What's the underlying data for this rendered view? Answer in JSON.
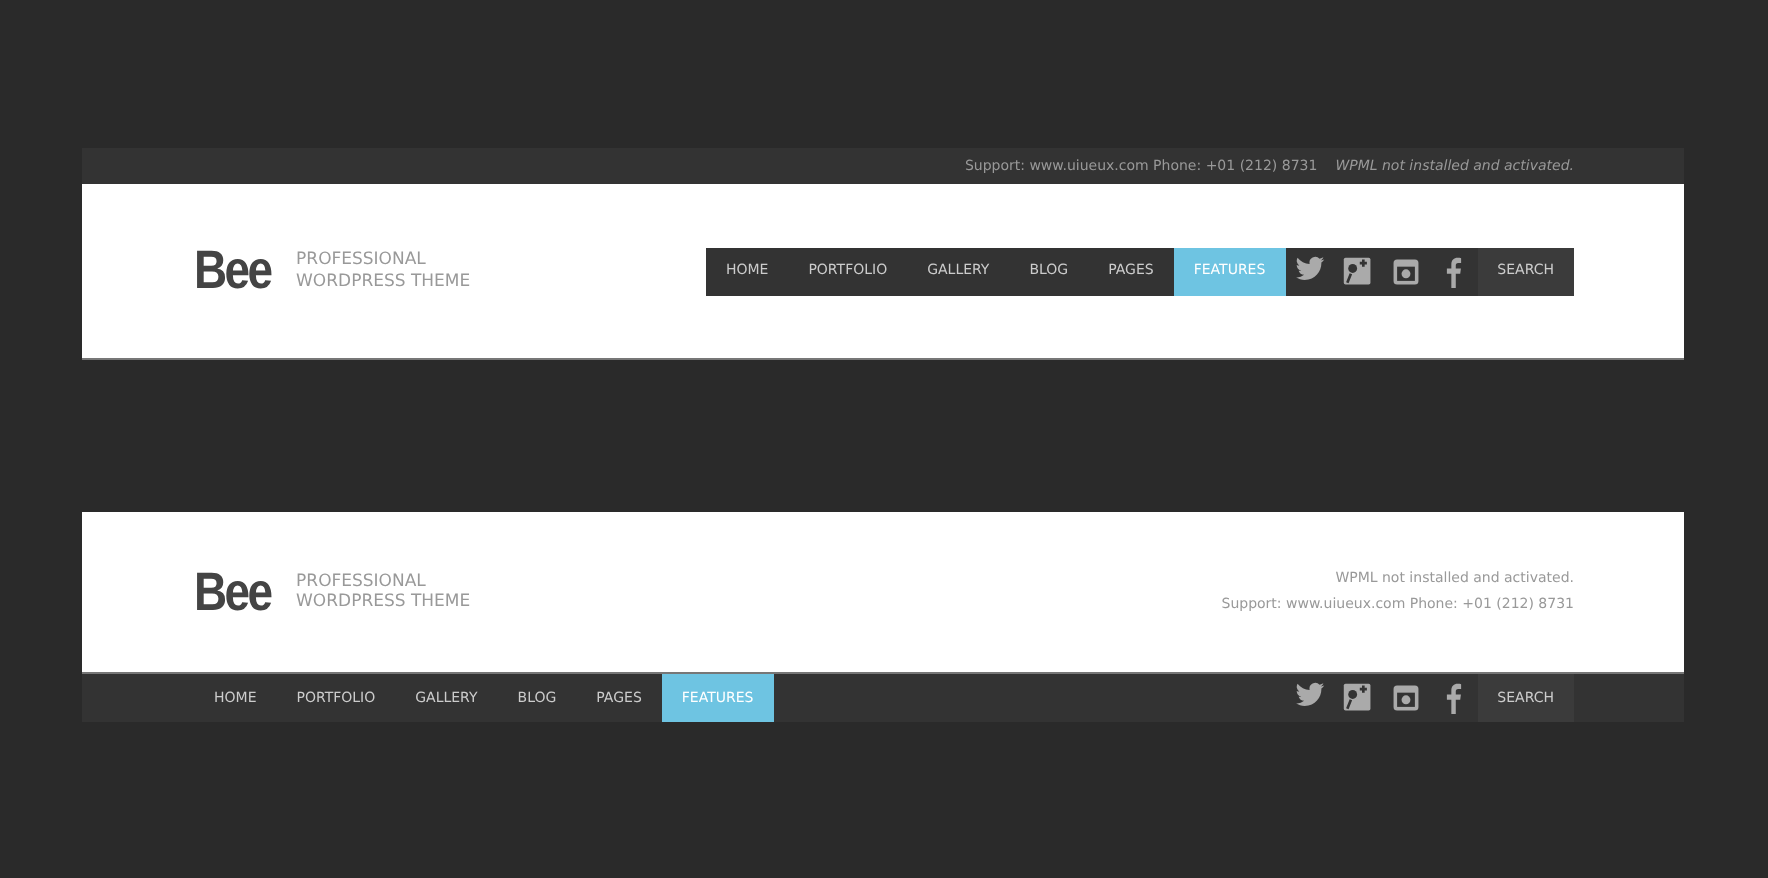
{
  "headers": [
    {
      "kind": "top-nav",
      "logo": "Bee",
      "tagline": [
        "PROFESSIONAL",
        "WORDPRESS THEME"
      ],
      "support": "Support: www.uiueux.com Phone: +01 (212) 8731",
      "wpml": "WPML not installed and activated.",
      "nav": [
        {
          "label": "HOME",
          "selected": false
        },
        {
          "label": "PORTFOLIO",
          "selected": false
        },
        {
          "label": "GALLERY",
          "selected": false
        },
        {
          "label": "BLOG",
          "selected": false
        },
        {
          "label": "PAGES",
          "selected": false
        },
        {
          "label": "FEATURES",
          "selected": true
        }
      ],
      "search": "SEARCH"
    },
    {
      "kind": "bottom-nav",
      "logo": "Bee",
      "tagline": [
        "PROFESSIONAL",
        "WORDPRESS THEME"
      ],
      "wpml": "WPML not installed and activated.",
      "support": "Support: www.uiueux.com Phone: +01 (212) 8731",
      "nav": [
        {
          "label": "HOME",
          "selected": false
        },
        {
          "label": "PORTFOLIO",
          "selected": false
        },
        {
          "label": "GALLERY",
          "selected": false
        },
        {
          "label": "BLOG",
          "selected": false
        },
        {
          "label": "PAGES",
          "selected": false
        },
        {
          "label": "FEATURES",
          "selected": true
        }
      ],
      "search": "SEARCH"
    }
  ]
}
